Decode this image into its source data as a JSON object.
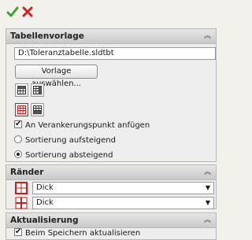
{
  "toolbar": {
    "ok_icon": "checkmark-icon",
    "cancel_icon": "close-icon"
  },
  "tabellenvorlage": {
    "title": "Tabellenvorlage",
    "collapse_glyph": "︽",
    "template_path": "D:\\Toleranztabelle.sldtbt",
    "choose_button": "Vorlage auswählen...",
    "anchor_checkbox": {
      "label": "An Verankerungspunkt anfügen",
      "checked": true
    },
    "sort_options": [
      {
        "label": "Sortierung aufsteigend",
        "selected": false
      },
      {
        "label": "Sortierung absteigend",
        "selected": true
      }
    ]
  },
  "raender": {
    "title": "Ränder",
    "collapse_glyph": "︽",
    "outer_border": "Dick",
    "inner_border": "Dick"
  },
  "aktualisierung": {
    "title": "Aktualisierung",
    "collapse_glyph": "︽",
    "save_checkbox": {
      "label": "Beim Speichern aktualisieren",
      "checked": true
    }
  },
  "colors": {
    "ok_green": "#3aa52e",
    "cancel_red": "#d42020",
    "border_red": "#c81e1e"
  }
}
